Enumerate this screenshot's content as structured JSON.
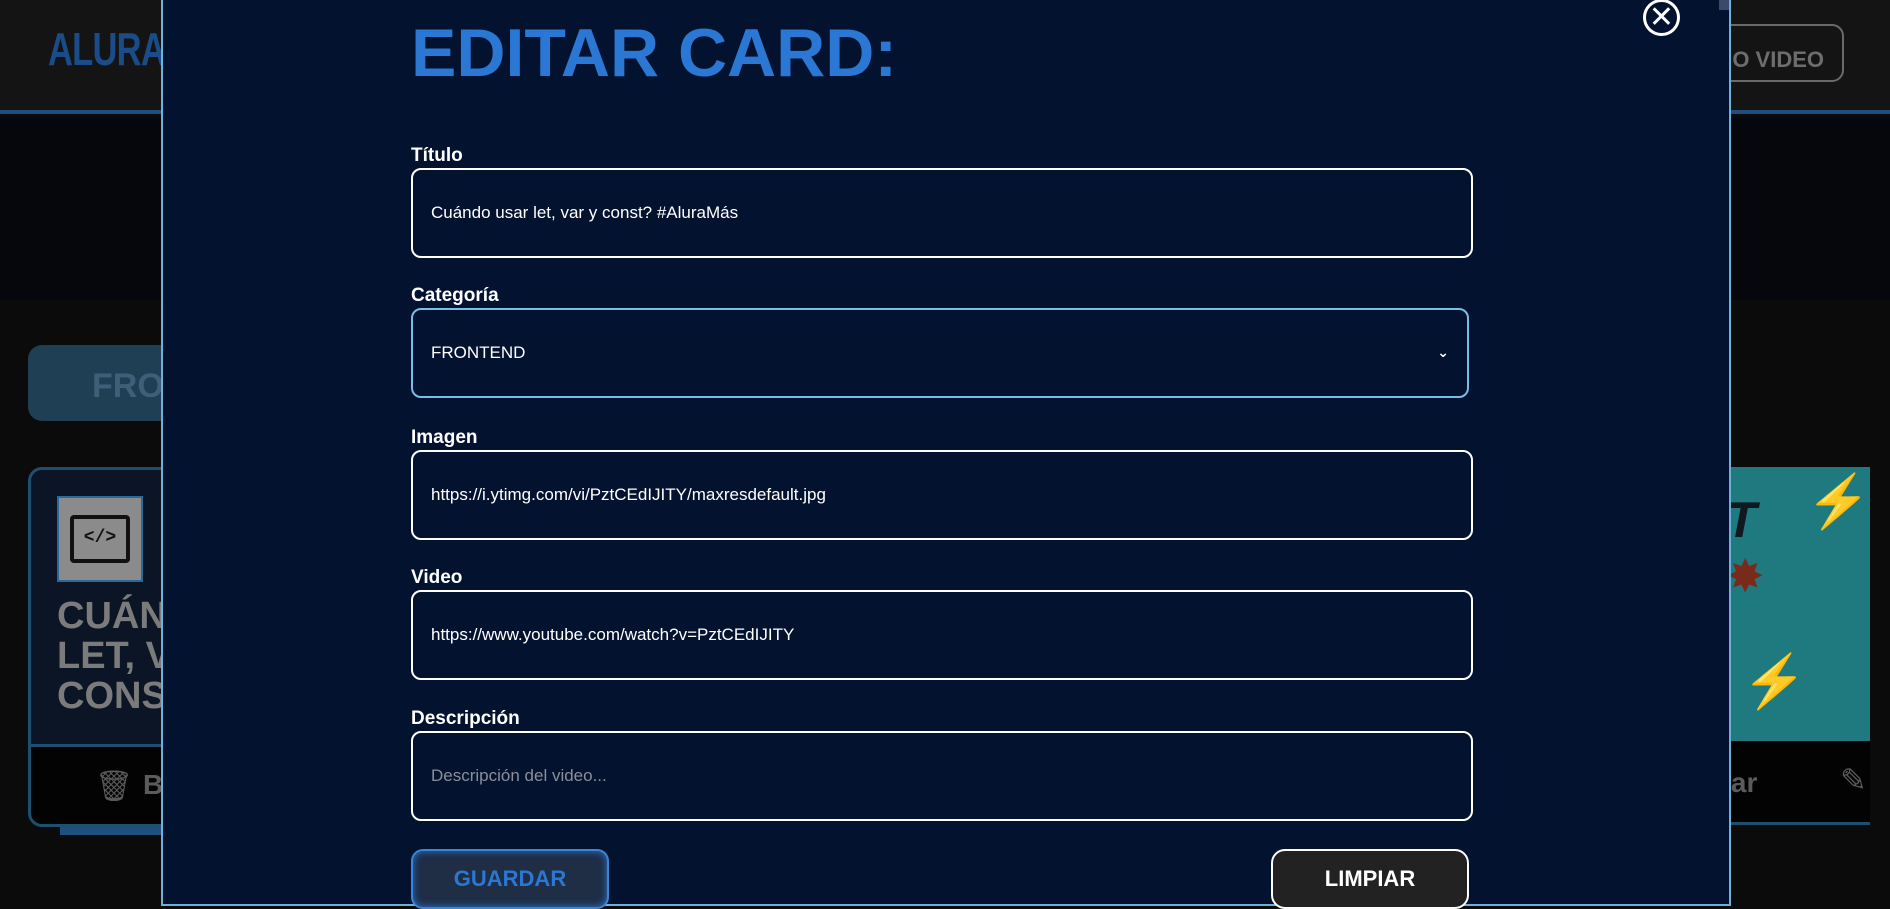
{
  "header": {
    "logo": "ALURA",
    "nuevo_video_label": "O VIDEO"
  },
  "background": {
    "category_tab": "FRO",
    "card_left": {
      "title": "CUÁND LET, V CONS",
      "delete_label": "B"
    },
    "card_right": {
      "edit_label": "rar"
    }
  },
  "modal": {
    "title": "EDITAR CARD:",
    "fields": {
      "titulo": {
        "label": "Título",
        "value": "Cuándo usar let, var y const? #AluraMás"
      },
      "categoria": {
        "label": "Categoría",
        "value": "FRONTEND"
      },
      "imagen": {
        "label": "Imagen",
        "value": "https://i.ytimg.com/vi/PztCEdIJITY/maxresdefault.jpg"
      },
      "video": {
        "label": "Video",
        "value": "https://www.youtube.com/watch?v=PztCEdIJITY"
      },
      "descripcion": {
        "label": "Descripción",
        "placeholder": "Descripción del video..."
      }
    },
    "buttons": {
      "guardar": "GUARDAR",
      "limpiar": "LIMPIAR",
      "close": "✕"
    }
  },
  "colors": {
    "modal_bg": "#03122f",
    "accent_blue": "#2a77d4",
    "modal_border": "#6fb0d8"
  }
}
